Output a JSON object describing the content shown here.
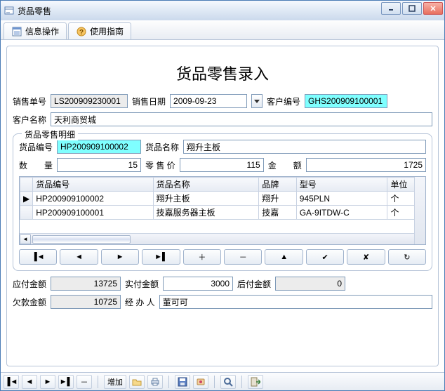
{
  "window": {
    "title": "货品零售"
  },
  "tabs": [
    {
      "label": "信息操作",
      "icon": "form-icon"
    },
    {
      "label": "使用指南",
      "icon": "help-icon"
    }
  ],
  "page": {
    "title": "货品零售录入"
  },
  "header": {
    "order_no_label": "销售单号",
    "order_no": "LS200909230001",
    "date_label": "销售日期",
    "date": "2009-09-23",
    "cust_no_label": "客户编号",
    "cust_no": "GHS200909100001",
    "cust_name_label": "客户名称",
    "cust_name": "天利商贸城"
  },
  "detail": {
    "legend": "货品零售明细",
    "prod_no_label": "货品编号",
    "prod_no": "HP200909100002",
    "prod_name_label": "货品名称",
    "prod_name": "翔升主板",
    "qty_label": "数　　量",
    "qty": "15",
    "price_label": "零 售 价",
    "price": "115",
    "amount_label": "金　　额",
    "amount": "1725",
    "columns": [
      "货品编号",
      "货品名称",
      "品牌",
      "型号",
      "单位"
    ],
    "rows": [
      {
        "no": "HP200909100002",
        "name": "翔升主板",
        "brand": "翔升",
        "model": "945PLN",
        "unit": "个",
        "current": true
      },
      {
        "no": "HP200909100001",
        "name": "技嘉服务器主板",
        "brand": "技嘉",
        "model": "GA-9ITDW-C",
        "unit": "个",
        "current": false
      }
    ],
    "nav": {
      "first": "▐◄",
      "prev": "◄",
      "next": "►",
      "last": "►▌",
      "add": "＋",
      "del": "－",
      "edit": "▲",
      "post": "✔",
      "cancel": "✘",
      "refresh": "↻"
    }
  },
  "totals": {
    "due_label": "应付金额",
    "due": "13725",
    "paid_label": "实付金额",
    "paid": "3000",
    "later_label": "后付金额",
    "later": "0",
    "debt_label": "欠款金额",
    "debt": "10725",
    "handler_label": "经 办 人",
    "handler": "董可可"
  },
  "toolbar": {
    "add_label": "增加"
  }
}
